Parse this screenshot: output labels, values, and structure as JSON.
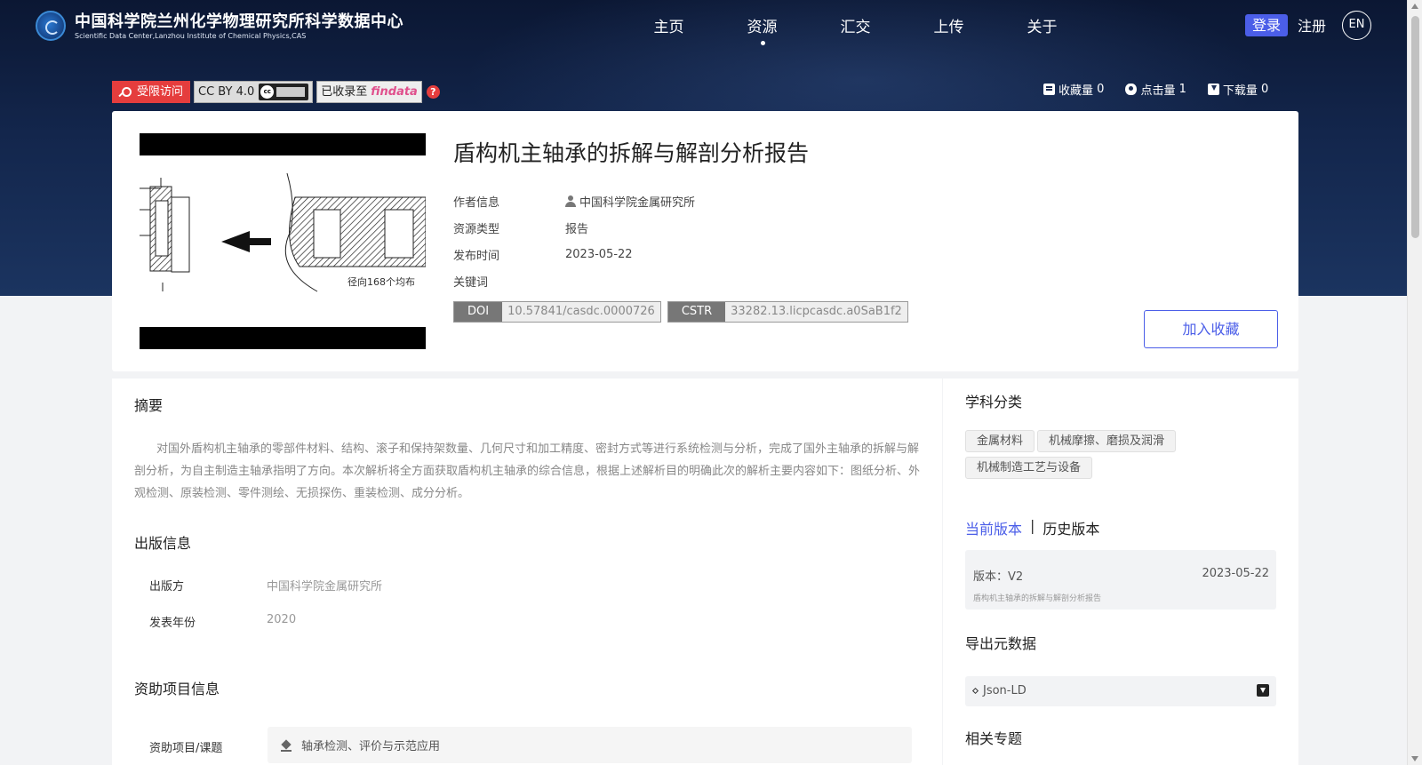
{
  "header": {
    "logo_title": "中国科学院兰州化学物理研究所科学数据中心",
    "logo_subtitle": "Scientific Data Center,Lanzhou Institute of Chemical Physics,CAS",
    "nav": [
      "主页",
      "资源",
      "汇交",
      "上传",
      "关于"
    ],
    "active_nav": "资源",
    "login": "登录",
    "register": "注册",
    "lang": "EN"
  },
  "badges": {
    "restricted": "受限访问",
    "license": "CC BY 4.0",
    "cc_mark": "cc",
    "indexed": "已收录至",
    "findata": "findata",
    "help": "?"
  },
  "stats": {
    "favorites_label": "收藏量",
    "favorites": "0",
    "clicks_label": "点击量",
    "clicks": "1",
    "downloads_label": "下载量",
    "downloads": "0"
  },
  "resource": {
    "title": "盾构机主轴承的拆解与解剖分析报告",
    "thumbnail_caption": "径向168个均布",
    "meta": [
      {
        "label": "作者信息",
        "value": "中国科学院金属研究所"
      },
      {
        "label": "资源类型",
        "value": "报告"
      },
      {
        "label": "发布时间",
        "value": "2023-05-22"
      },
      {
        "label": "关键词",
        "value": ""
      }
    ],
    "doi_key": "DOI",
    "doi_value": "10.57841/casdc.0000726",
    "cstr_key": "CSTR",
    "cstr_value": "33282.13.licpcasdc.a0SaB1f2",
    "fav_button": "加入收藏"
  },
  "abstract": {
    "title": "摘要",
    "text": "对国外盾构机主轴承的零部件材料、结构、滚子和保持架数量、几何尺寸和加工精度、密封方式等进行系统检测与分析，完成了国外主轴承的拆解与解剖分析，为自主制造主轴承指明了方向。本次解析将全方面获取盾构机主轴承的综合信息，根据上述解析目的明确此次的解析主要内容如下：图纸分析、外观检测、原装检测、零件测绘、无损探伤、重装检测、成分分析。"
  },
  "publication": {
    "title": "出版信息",
    "publisher_label": "出版方",
    "publisher": "中国科学院金属研究所",
    "year_label": "发表年份",
    "year": "2020"
  },
  "funding": {
    "title": "资助项目信息",
    "label": "资助项目/课题",
    "value": "轴承检测、评价与示范应用"
  },
  "sidebar": {
    "subject_title": "学科分类",
    "subjects": [
      "金属材料",
      "机械摩擦、磨损及润滑",
      "机械制造工艺与设备"
    ],
    "current_version": "当前版本",
    "separator": "|",
    "history_version": "历史版本",
    "version_label": "版本：V2",
    "version_date": "2023-05-22",
    "version_desc": "盾构机主轴承的拆解与解剖分析报告",
    "export_title": "导出元数据",
    "export_format": "Json-LD",
    "related_title": "相关专题"
  },
  "colors": {
    "accent": "#4b5ee8",
    "restricted": "#e53d3d",
    "header_bg": "#0b1733"
  }
}
